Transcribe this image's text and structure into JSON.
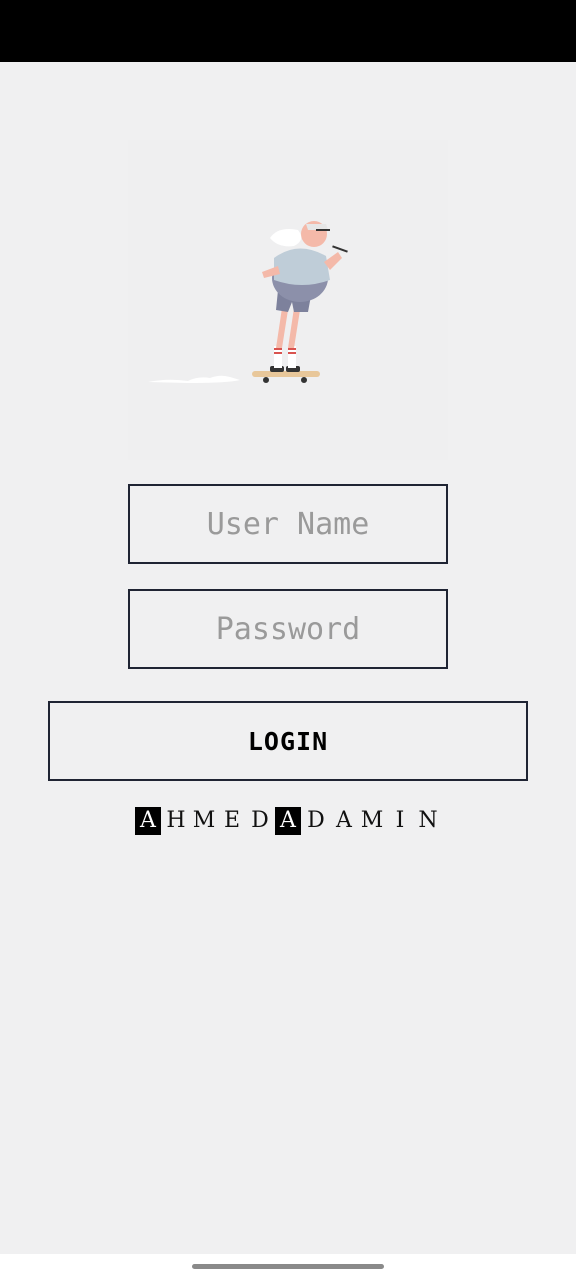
{
  "login_form": {
    "username_placeholder": "User Name",
    "password_placeholder": "Password",
    "login_label": "LOGIN"
  },
  "credit": {
    "text": "AHMED ADAMIN",
    "letters": [
      "A",
      "H",
      "M",
      "E",
      "D",
      "A",
      "D",
      "A",
      "M",
      "I",
      "N"
    ],
    "inverted_letters": [
      0,
      5
    ]
  },
  "colors": {
    "background": "#f0f0f1",
    "border": "#1f2433",
    "placeholder": "#9a9a9a",
    "status_bar": "#000000"
  }
}
